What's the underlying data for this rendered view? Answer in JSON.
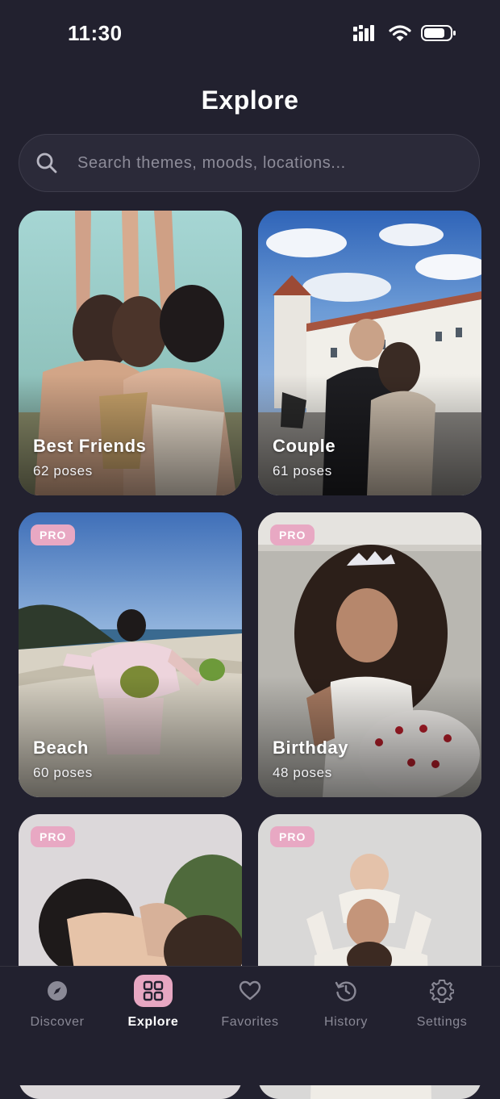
{
  "status": {
    "time": "11:30"
  },
  "header": {
    "title": "Explore"
  },
  "search": {
    "placeholder": "Search themes, moods, locations..."
  },
  "cards": [
    {
      "name": "Best Friends",
      "count": "62 poses",
      "pro": ""
    },
    {
      "name": "Couple",
      "count": "61 poses",
      "pro": ""
    },
    {
      "name": "Beach",
      "count": "60 poses",
      "pro": "PRO"
    },
    {
      "name": "Birthday",
      "count": "48 poses",
      "pro": "PRO"
    },
    {
      "name": "",
      "count": "",
      "pro": "PRO"
    },
    {
      "name": "",
      "count": "",
      "pro": "PRO"
    }
  ],
  "nav": {
    "items": [
      {
        "label": "Discover",
        "icon": "compass-icon"
      },
      {
        "label": "Explore",
        "icon": "grid-icon"
      },
      {
        "label": "Favorites",
        "icon": "heart-icon"
      },
      {
        "label": "History",
        "icon": "history-icon"
      },
      {
        "label": "Settings",
        "icon": "gear-icon"
      }
    ],
    "active": "Explore"
  },
  "colors": {
    "background": "#22212f",
    "accent": "#e7a7c2",
    "pro_badge": "#e8a8c3"
  }
}
